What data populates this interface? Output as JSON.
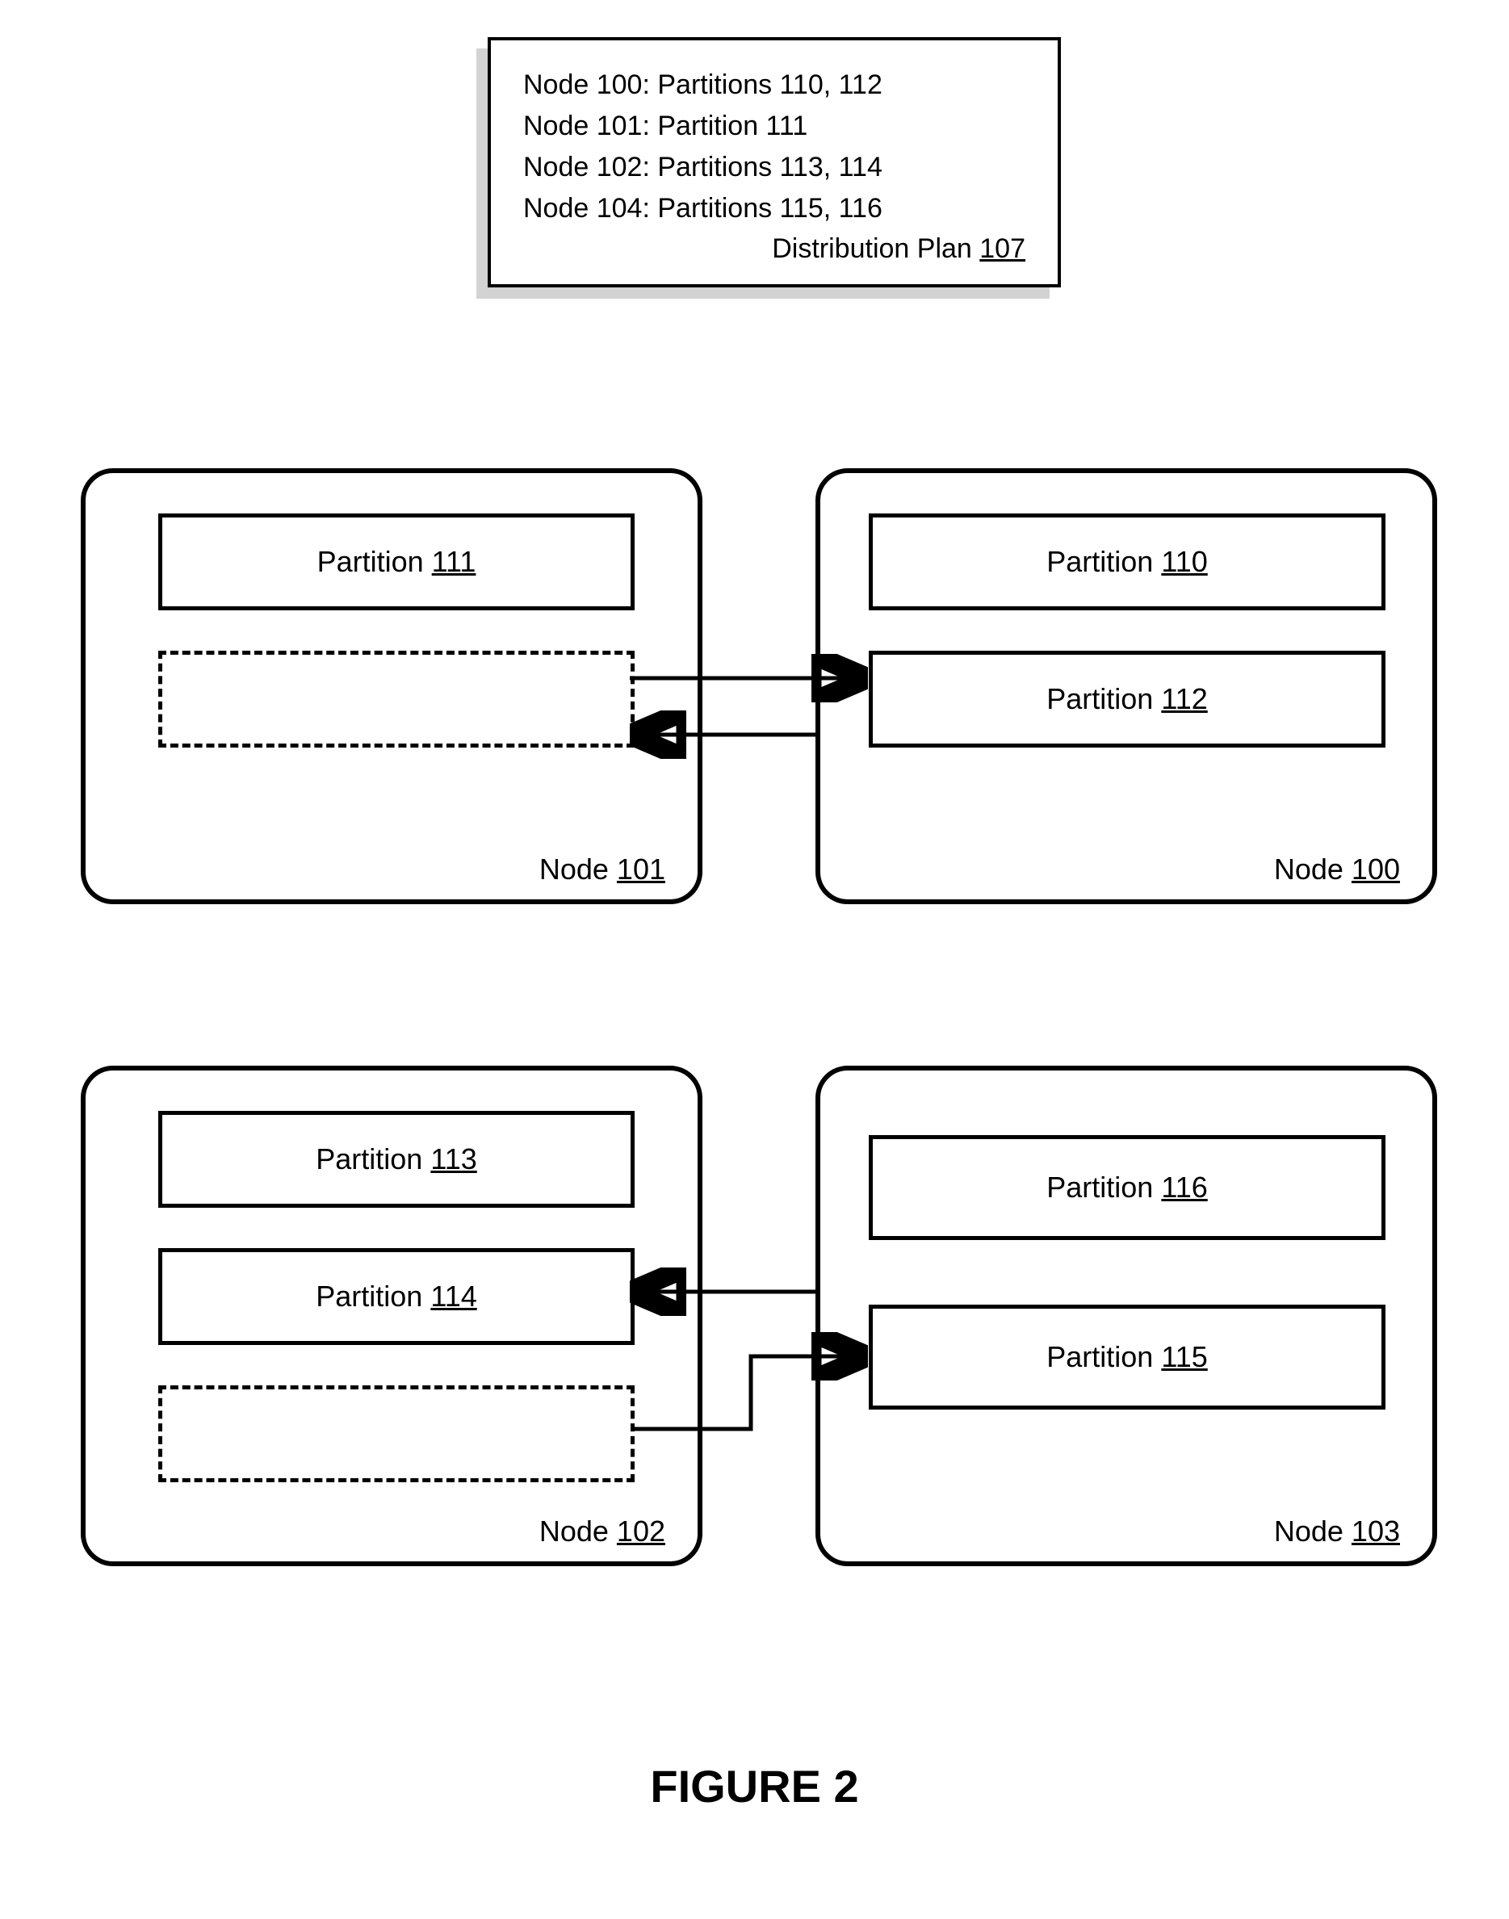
{
  "plan": {
    "lines": [
      {
        "node": "Node 100",
        "partitions": "Partitions 110, 112"
      },
      {
        "node": "Node 101",
        "partitions": "Partition 111"
      },
      {
        "node": "Node 102",
        "partitions": "Partitions 113, 114"
      },
      {
        "node": "Node 104",
        "partitions": "Partitions 115, 116"
      }
    ],
    "caption_label": "Distribution Plan",
    "caption_ref": "107"
  },
  "nodes": {
    "n101": {
      "label": "Node",
      "ref": "101",
      "partition1_label": "Partition",
      "partition1_ref": "111"
    },
    "n100": {
      "label": "Node",
      "ref": "100",
      "partition1_label": "Partition",
      "partition1_ref": "110",
      "partition2_label": "Partition",
      "partition2_ref": "112"
    },
    "n102": {
      "label": "Node",
      "ref": "102",
      "partition1_label": "Partition",
      "partition1_ref": "113",
      "partition2_label": "Partition",
      "partition2_ref": "114"
    },
    "n103": {
      "label": "Node",
      "ref": "103",
      "partition1_label": "Partition",
      "partition1_ref": "116",
      "partition2_label": "Partition",
      "partition2_ref": "115"
    }
  },
  "figure_caption": "FIGURE 2",
  "chart_data": {
    "type": "diagram",
    "title": "FIGURE 2",
    "distribution_plan": {
      "ref": 107,
      "entries": [
        {
          "node": 100,
          "partitions": [
            110,
            112
          ]
        },
        {
          "node": 101,
          "partitions": [
            111
          ]
        },
        {
          "node": 102,
          "partitions": [
            113,
            114
          ]
        },
        {
          "node": 104,
          "partitions": [
            115,
            116
          ]
        }
      ]
    },
    "nodes": [
      {
        "id": 101,
        "partitions": [
          111
        ],
        "ghost_slots": 1
      },
      {
        "id": 100,
        "partitions": [
          110,
          112
        ],
        "ghost_slots": 0
      },
      {
        "id": 102,
        "partitions": [
          113,
          114
        ],
        "ghost_slots": 1
      },
      {
        "id": 103,
        "partitions": [
          116,
          115
        ],
        "ghost_slots": 0
      }
    ],
    "arrows": [
      {
        "from_node": 101,
        "from_slot": "ghost",
        "to_node": 100,
        "to_partition": 112,
        "bidirectional": true
      },
      {
        "from_node": 100,
        "from_partition": 112,
        "to_node": 101,
        "to_slot": "ghost",
        "bidirectional": true
      },
      {
        "from_node": 103,
        "to_node": 102,
        "to_partition": 114
      },
      {
        "from_node": 102,
        "from_slot": "ghost",
        "to_node": 103,
        "to_partition": 115
      }
    ]
  }
}
